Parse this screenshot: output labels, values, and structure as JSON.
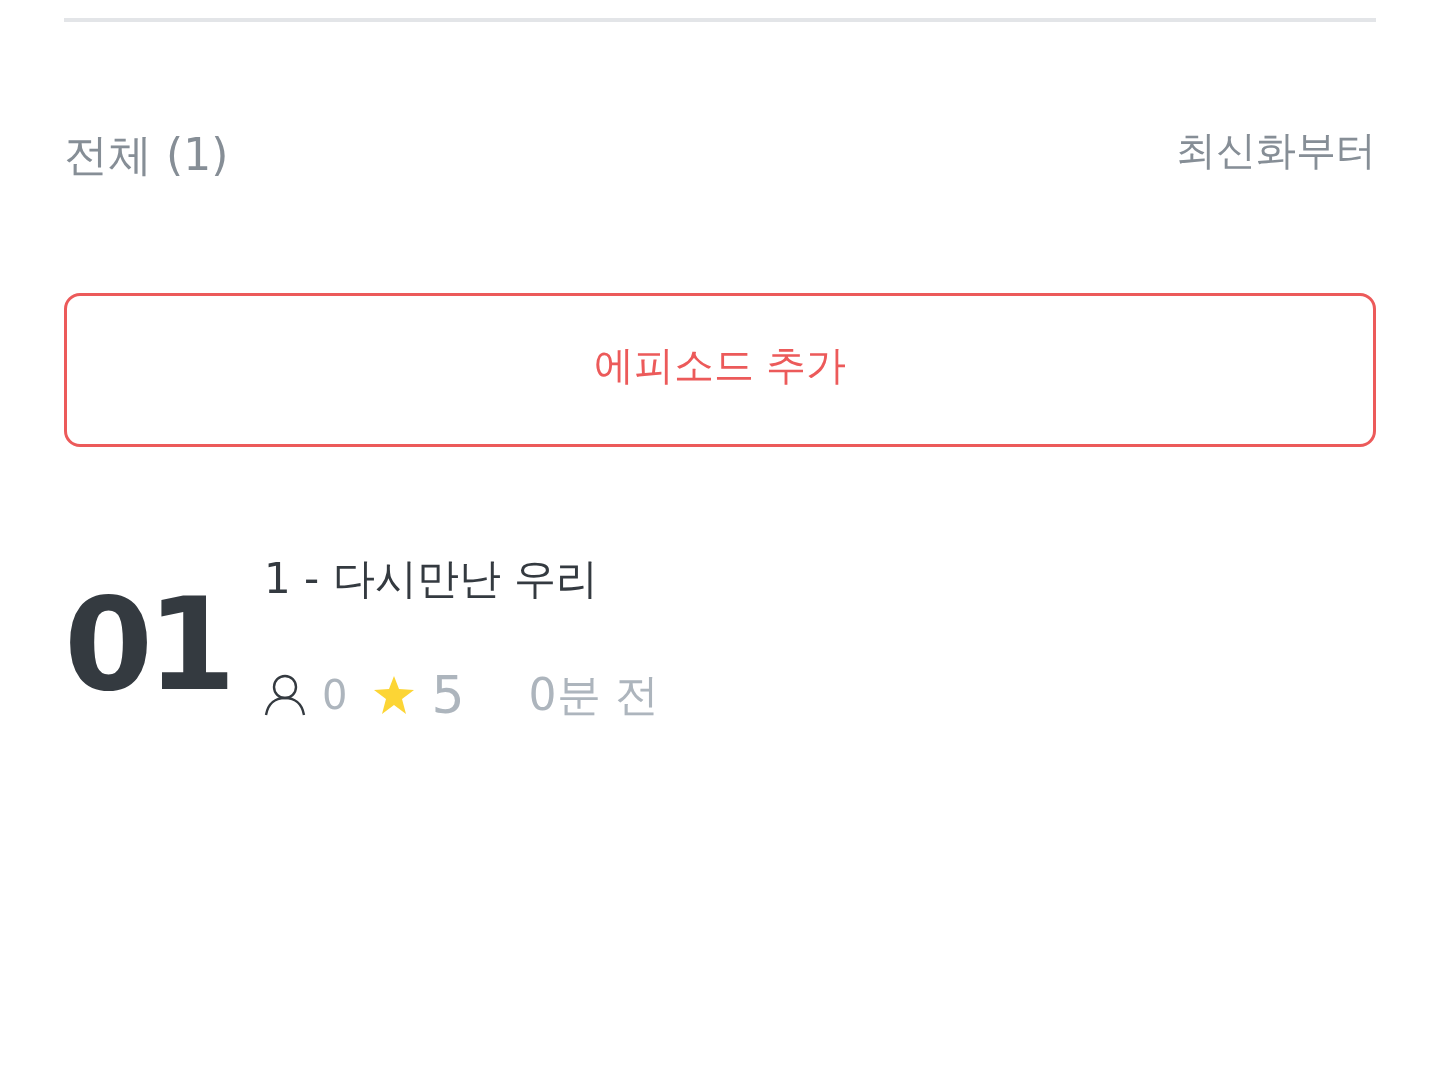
{
  "header": {
    "total_label": "전체 (1)",
    "sort_label": "최신화부터"
  },
  "add_button": {
    "label": "에피소드 추가"
  },
  "episodes": [
    {
      "number": "01",
      "title": "1 - 다시만난 우리",
      "views": "0",
      "rating": "5",
      "time": "0분 전"
    }
  ]
}
